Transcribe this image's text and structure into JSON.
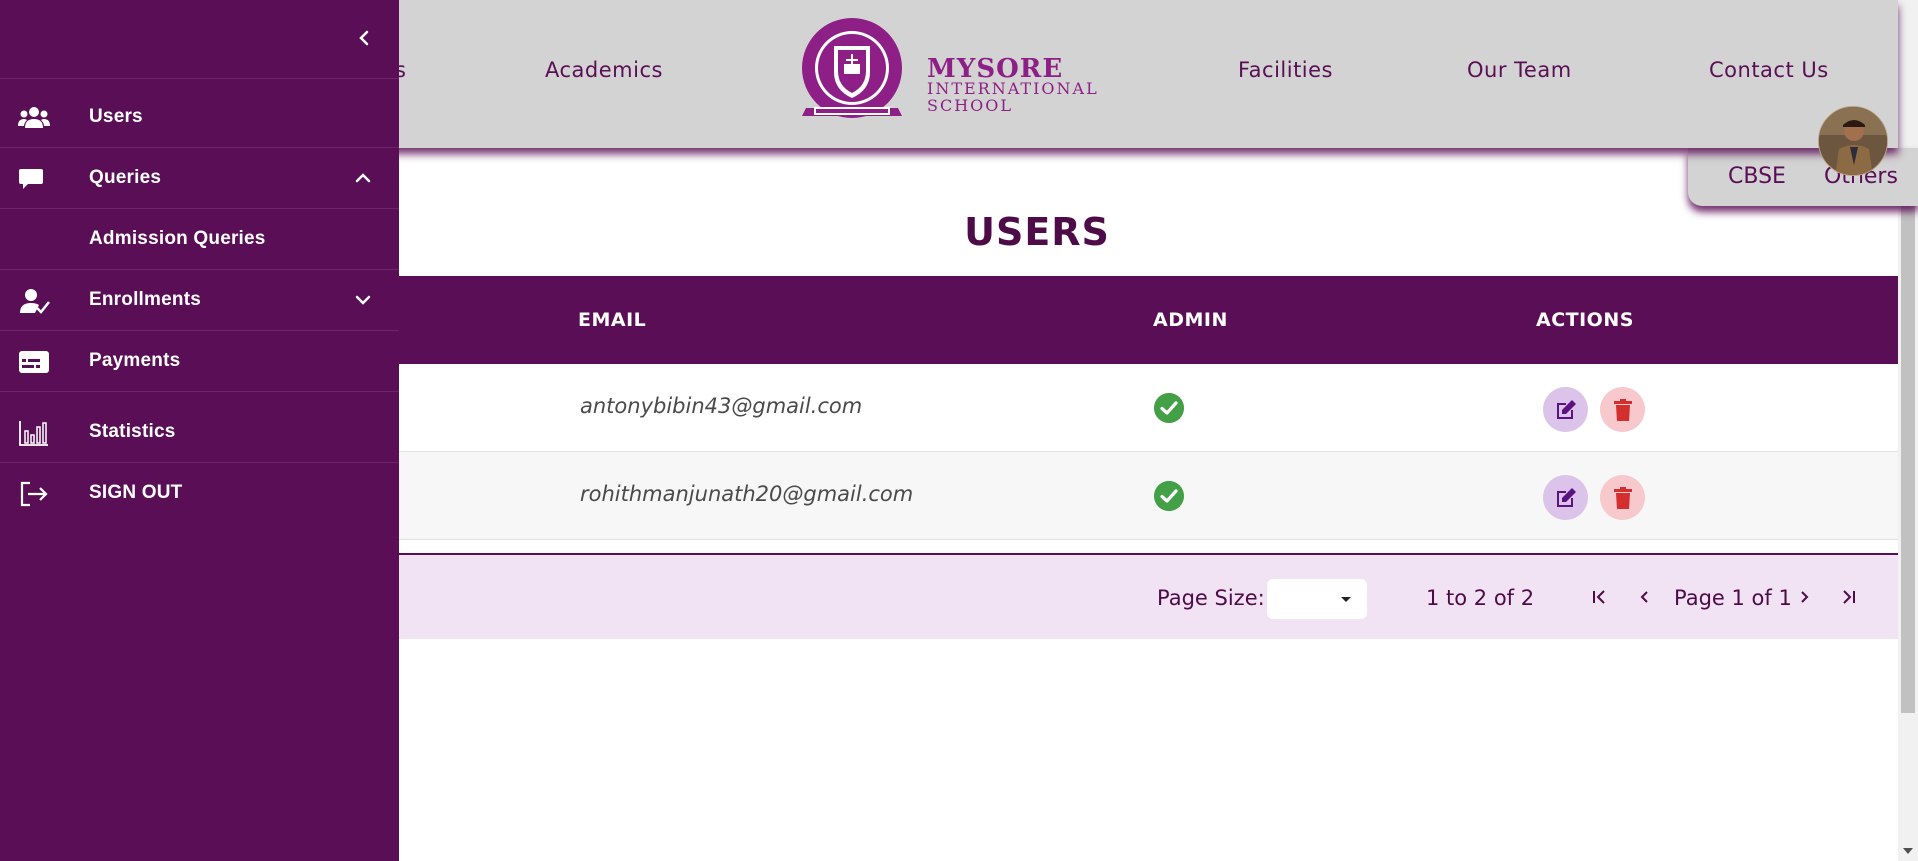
{
  "nav": {
    "items": [
      {
        "label": "s"
      },
      {
        "label": "Academics"
      },
      {
        "label": "Facilities"
      },
      {
        "label": "Our Team"
      },
      {
        "label": "Contact Us"
      }
    ],
    "logo": {
      "title": "MYSORE",
      "subtitle_line1": "INTERNATIONAL",
      "subtitle_line2": "SCHOOL",
      "emblem_top_text": "EMPOWER · EXCEL · EDUCATE",
      "emblem_banner": "PURSUING EXCELLENCE"
    },
    "subnav": [
      {
        "label": "CBSE"
      },
      {
        "label": "Others"
      }
    ]
  },
  "sidebar": {
    "items": [
      {
        "label": "Users",
        "icon": "users-icon"
      },
      {
        "label": "Queries",
        "icon": "chat-bubble-icon",
        "expanded": true
      },
      {
        "label": "Admission Queries"
      },
      {
        "label": "Enrollments",
        "icon": "user-check-icon",
        "expanded": false
      },
      {
        "label": "Payments",
        "icon": "payment-card-icon"
      },
      {
        "label": "Statistics",
        "icon": "bar-chart-icon"
      },
      {
        "label": "SIGN OUT",
        "icon": "sign-out-icon"
      }
    ]
  },
  "main": {
    "title": "USERS",
    "columns": [
      "EMAIL",
      "ADMIN",
      "ACTIONS"
    ],
    "rows": [
      {
        "email": "antonybibin43@gmail.com",
        "admin": true
      },
      {
        "email": "rohithmanjunath20@gmail.com",
        "admin": true
      }
    ],
    "pagination": {
      "page_size_label": "Page Size:",
      "page_size_value": "",
      "range": "1 to 2 of 2",
      "page_info": "Page 1 of 1"
    }
  },
  "colors": {
    "brand": "#5a0e55",
    "nav_bg": "#d3d3d3",
    "pager_bg": "#f1e3f3",
    "admin_check": "#43a047",
    "edit_btn": "#dcc3ea",
    "delete_btn": "#f7c8cc",
    "delete_icon": "#d32f2f",
    "edit_icon": "#5a1380"
  }
}
